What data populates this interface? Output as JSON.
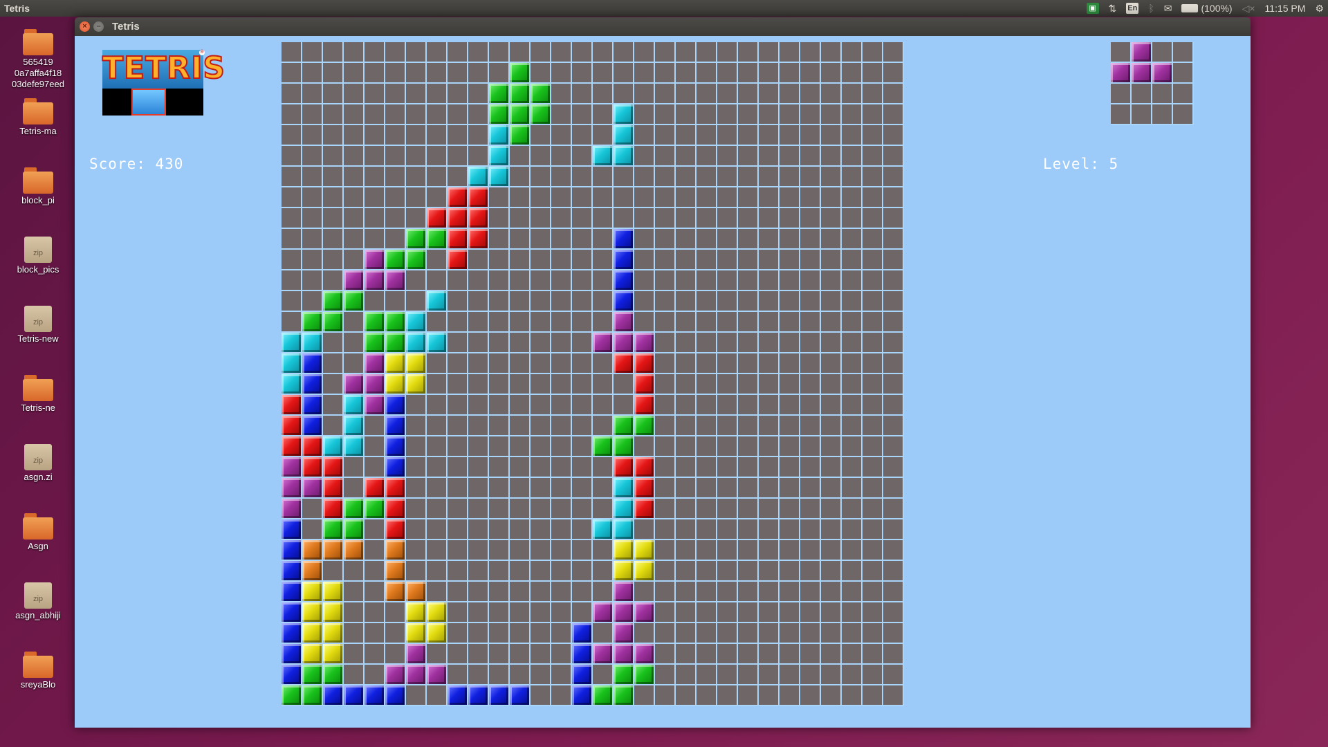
{
  "top_panel": {
    "app_name": "Tetris",
    "keyboard": "En",
    "battery": "(100%)",
    "time": "11:15 PM",
    "icons": [
      "app-indicator-icon",
      "network-arrows-icon",
      "keyboard-layout-icon",
      "bluetooth-icon",
      "mail-icon",
      "battery-icon",
      "volume-muted-icon",
      "settings-gear-icon"
    ]
  },
  "desktop": {
    "items": [
      {
        "label": "565419\n0a7affa4f18\n03defe97eed",
        "icon": "folder-icon"
      },
      {
        "label": "Tetris-ma",
        "icon": "folder-icon"
      },
      {
        "label": "block_pi",
        "icon": "folder-icon"
      },
      {
        "label": "block_pics",
        "icon": "zip-icon"
      },
      {
        "label": "Tetris-new",
        "icon": "zip-icon"
      },
      {
        "label": "Tetris-ne",
        "icon": "folder-icon"
      },
      {
        "label": "asgn.zi",
        "icon": "zip-icon"
      },
      {
        "label": "Asgn",
        "icon": "folder-icon"
      },
      {
        "label": "asgn_abhiji",
        "icon": "zip-icon"
      },
      {
        "label": "sreyaBlo",
        "icon": "folder-icon"
      }
    ],
    "zip_badge": "zip"
  },
  "window": {
    "title": "Tetris",
    "close_glyph": "×",
    "min_glyph": "–"
  },
  "game": {
    "logo_text": "TETRIS",
    "score_text": "Score: 430",
    "level_text": "Level: 5",
    "colors": {
      "C": "#16c6d8",
      "G": "#19c21c",
      "R": "#e51616",
      "P": "#a0319f",
      "B": "#1020e0",
      "Y": "#e3dc10",
      "O": "#e07a1e",
      "empty": "#6f6667",
      "grid_line": "#a9d5fb"
    },
    "board_cols": 30,
    "board": [
      "..............................",
      "...........G..................",
      "..........GGG.................",
      "..........GGG...C.............",
      "..........CG....C.............",
      "..........C....CC.............",
      ".........CC...................",
      "........RR....................",
      ".......RRR....................",
      "......GGRR......B.............",
      "....PGG.R.......B.............",
      "...PPP..........B.............",
      "..GG...C........B.............",
      ".GG.GGC.........P.............",
      "CC..GGCC.......PPP............",
      "CB..PYY.........RR............",
      "CB.PPYY..........R............",
      "RB.CPB...........R............",
      "RB.C.B..........GG............",
      "RRCC.B.........GG.............",
      "PRR..B..........RR............",
      "PPR.RR..........CR............",
      "P.RGGR..........CR............",
      "B.GG.R.........CC.............",
      "BOOO.O..........YY............",
      "BO...O..........YY............",
      "BYY..OO.........P.............",
      "BYY...YY.......PPP............",
      "BYY...YY......B.P.............",
      "BYY...P.......BPPP............",
      "BGG..PPP......B.GG............",
      "GGBBBB..BBBB..BGG............."
    ],
    "preview": [
      ".P..",
      "PPP.",
      "....",
      "...."
    ]
  }
}
